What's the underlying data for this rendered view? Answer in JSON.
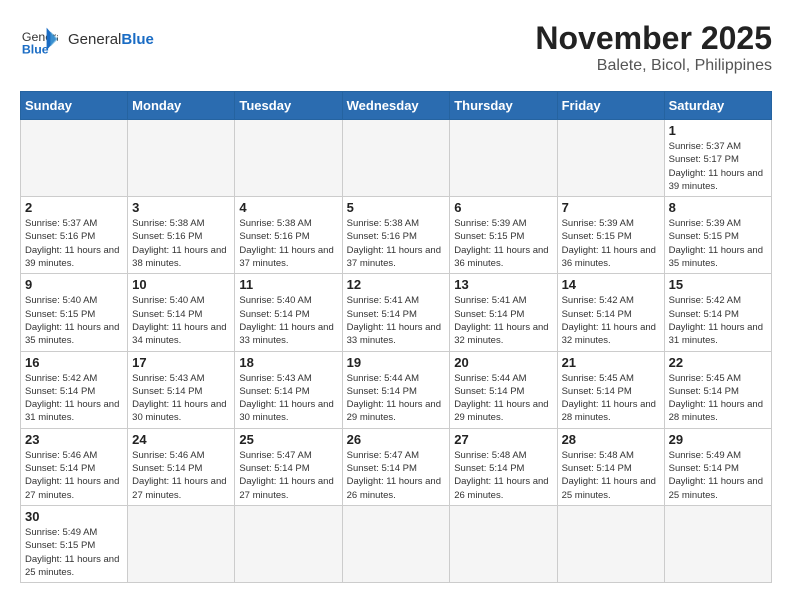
{
  "logo": {
    "text_general": "General",
    "text_blue": "Blue"
  },
  "title": "November 2025",
  "subtitle": "Balete, Bicol, Philippines",
  "weekdays": [
    "Sunday",
    "Monday",
    "Tuesday",
    "Wednesday",
    "Thursday",
    "Friday",
    "Saturday"
  ],
  "days": [
    {
      "num": "",
      "info": ""
    },
    {
      "num": "",
      "info": ""
    },
    {
      "num": "",
      "info": ""
    },
    {
      "num": "",
      "info": ""
    },
    {
      "num": "",
      "info": ""
    },
    {
      "num": "",
      "info": ""
    },
    {
      "num": "1",
      "info": "Sunrise: 5:37 AM\nSunset: 5:17 PM\nDaylight: 11 hours and 39 minutes."
    },
    {
      "num": "2",
      "info": "Sunrise: 5:37 AM\nSunset: 5:16 PM\nDaylight: 11 hours and 39 minutes."
    },
    {
      "num": "3",
      "info": "Sunrise: 5:38 AM\nSunset: 5:16 PM\nDaylight: 11 hours and 38 minutes."
    },
    {
      "num": "4",
      "info": "Sunrise: 5:38 AM\nSunset: 5:16 PM\nDaylight: 11 hours and 37 minutes."
    },
    {
      "num": "5",
      "info": "Sunrise: 5:38 AM\nSunset: 5:16 PM\nDaylight: 11 hours and 37 minutes."
    },
    {
      "num": "6",
      "info": "Sunrise: 5:39 AM\nSunset: 5:15 PM\nDaylight: 11 hours and 36 minutes."
    },
    {
      "num": "7",
      "info": "Sunrise: 5:39 AM\nSunset: 5:15 PM\nDaylight: 11 hours and 36 minutes."
    },
    {
      "num": "8",
      "info": "Sunrise: 5:39 AM\nSunset: 5:15 PM\nDaylight: 11 hours and 35 minutes."
    },
    {
      "num": "9",
      "info": "Sunrise: 5:40 AM\nSunset: 5:15 PM\nDaylight: 11 hours and 35 minutes."
    },
    {
      "num": "10",
      "info": "Sunrise: 5:40 AM\nSunset: 5:14 PM\nDaylight: 11 hours and 34 minutes."
    },
    {
      "num": "11",
      "info": "Sunrise: 5:40 AM\nSunset: 5:14 PM\nDaylight: 11 hours and 33 minutes."
    },
    {
      "num": "12",
      "info": "Sunrise: 5:41 AM\nSunset: 5:14 PM\nDaylight: 11 hours and 33 minutes."
    },
    {
      "num": "13",
      "info": "Sunrise: 5:41 AM\nSunset: 5:14 PM\nDaylight: 11 hours and 32 minutes."
    },
    {
      "num": "14",
      "info": "Sunrise: 5:42 AM\nSunset: 5:14 PM\nDaylight: 11 hours and 32 minutes."
    },
    {
      "num": "15",
      "info": "Sunrise: 5:42 AM\nSunset: 5:14 PM\nDaylight: 11 hours and 31 minutes."
    },
    {
      "num": "16",
      "info": "Sunrise: 5:42 AM\nSunset: 5:14 PM\nDaylight: 11 hours and 31 minutes."
    },
    {
      "num": "17",
      "info": "Sunrise: 5:43 AM\nSunset: 5:14 PM\nDaylight: 11 hours and 30 minutes."
    },
    {
      "num": "18",
      "info": "Sunrise: 5:43 AM\nSunset: 5:14 PM\nDaylight: 11 hours and 30 minutes."
    },
    {
      "num": "19",
      "info": "Sunrise: 5:44 AM\nSunset: 5:14 PM\nDaylight: 11 hours and 29 minutes."
    },
    {
      "num": "20",
      "info": "Sunrise: 5:44 AM\nSunset: 5:14 PM\nDaylight: 11 hours and 29 minutes."
    },
    {
      "num": "21",
      "info": "Sunrise: 5:45 AM\nSunset: 5:14 PM\nDaylight: 11 hours and 28 minutes."
    },
    {
      "num": "22",
      "info": "Sunrise: 5:45 AM\nSunset: 5:14 PM\nDaylight: 11 hours and 28 minutes."
    },
    {
      "num": "23",
      "info": "Sunrise: 5:46 AM\nSunset: 5:14 PM\nDaylight: 11 hours and 27 minutes."
    },
    {
      "num": "24",
      "info": "Sunrise: 5:46 AM\nSunset: 5:14 PM\nDaylight: 11 hours and 27 minutes."
    },
    {
      "num": "25",
      "info": "Sunrise: 5:47 AM\nSunset: 5:14 PM\nDaylight: 11 hours and 27 minutes."
    },
    {
      "num": "26",
      "info": "Sunrise: 5:47 AM\nSunset: 5:14 PM\nDaylight: 11 hours and 26 minutes."
    },
    {
      "num": "27",
      "info": "Sunrise: 5:48 AM\nSunset: 5:14 PM\nDaylight: 11 hours and 26 minutes."
    },
    {
      "num": "28",
      "info": "Sunrise: 5:48 AM\nSunset: 5:14 PM\nDaylight: 11 hours and 25 minutes."
    },
    {
      "num": "29",
      "info": "Sunrise: 5:49 AM\nSunset: 5:14 PM\nDaylight: 11 hours and 25 minutes."
    },
    {
      "num": "30",
      "info": "Sunrise: 5:49 AM\nSunset: 5:15 PM\nDaylight: 11 hours and 25 minutes."
    },
    {
      "num": "",
      "info": ""
    },
    {
      "num": "",
      "info": ""
    },
    {
      "num": "",
      "info": ""
    },
    {
      "num": "",
      "info": ""
    },
    {
      "num": "",
      "info": ""
    },
    {
      "num": "",
      "info": ""
    }
  ]
}
